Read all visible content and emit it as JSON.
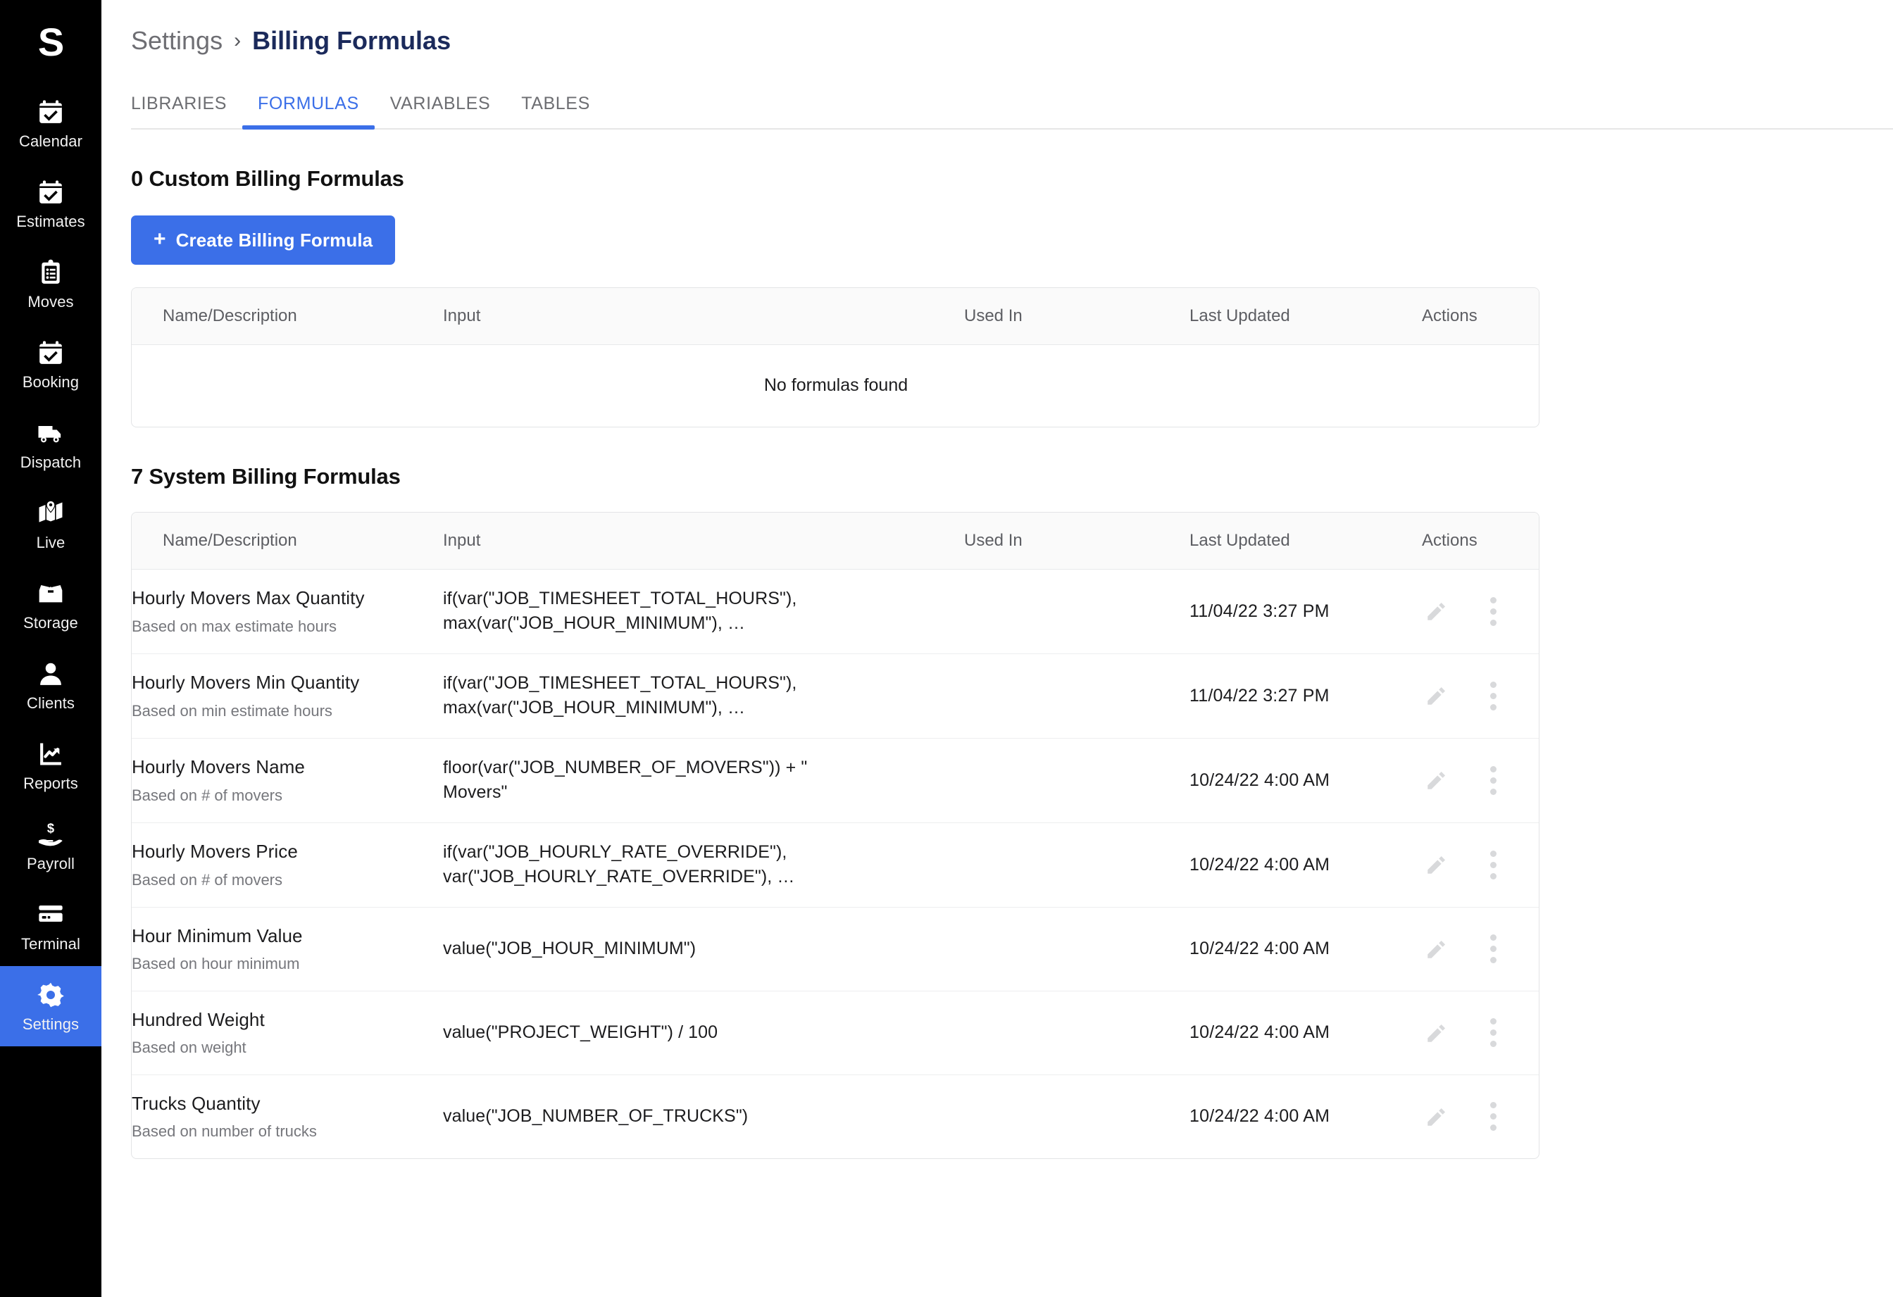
{
  "sidebar": {
    "brand": "S",
    "items": [
      {
        "label": "Calendar",
        "icon": "calendar-check-icon",
        "active": false
      },
      {
        "label": "Estimates",
        "icon": "calendar-check-icon",
        "active": false
      },
      {
        "label": "Moves",
        "icon": "clipboard-list-icon",
        "active": false
      },
      {
        "label": "Booking",
        "icon": "calendar-check-icon",
        "active": false
      },
      {
        "label": "Dispatch",
        "icon": "truck-icon",
        "active": false
      },
      {
        "label": "Live",
        "icon": "map-pin-icon",
        "active": false
      },
      {
        "label": "Storage",
        "icon": "open-box-icon",
        "active": false
      },
      {
        "label": "Clients",
        "icon": "person-icon",
        "active": false
      },
      {
        "label": "Reports",
        "icon": "chart-line-icon",
        "active": false
      },
      {
        "label": "Payroll",
        "icon": "hand-dollar-icon",
        "active": false
      },
      {
        "label": "Terminal",
        "icon": "credit-card-icon",
        "active": false
      },
      {
        "label": "Settings",
        "icon": "gear-icon",
        "active": true
      }
    ]
  },
  "breadcrumb": {
    "parent": "Settings",
    "separator": "›",
    "current": "Billing Formulas"
  },
  "tabs": [
    {
      "label": "LIBRARIES",
      "active": false
    },
    {
      "label": "FORMULAS",
      "active": true
    },
    {
      "label": "VARIABLES",
      "active": false
    },
    {
      "label": "TABLES",
      "active": false
    }
  ],
  "custom_section": {
    "title": "0 Custom Billing Formulas",
    "create_button": "Create Billing Formula",
    "create_button_plus": "+",
    "columns": [
      "Name/Description",
      "Input",
      "Used In",
      "Last Updated",
      "Actions"
    ],
    "empty_message": "No formulas found"
  },
  "system_section": {
    "title": "7 System Billing Formulas",
    "columns": [
      "Name/Description",
      "Input",
      "Used In",
      "Last Updated",
      "Actions"
    ],
    "rows": [
      {
        "name": "Hourly Movers Max Quantity",
        "description": "Based on max estimate hours",
        "input": "if(var(\"JOB_TIMESHEET_TOTAL_HOURS\"),\nmax(var(\"JOB_HOUR_MINIMUM\"), …",
        "used_in": "",
        "last_updated": "11/04/22 3:27 PM"
      },
      {
        "name": "Hourly Movers Min Quantity",
        "description": "Based on min estimate hours",
        "input": "if(var(\"JOB_TIMESHEET_TOTAL_HOURS\"),\nmax(var(\"JOB_HOUR_MINIMUM\"), …",
        "used_in": "",
        "last_updated": "11/04/22 3:27 PM"
      },
      {
        "name": "Hourly Movers Name",
        "description": "Based on # of movers",
        "input": "floor(var(\"JOB_NUMBER_OF_MOVERS\")) + \"\nMovers\"",
        "used_in": "",
        "last_updated": "10/24/22 4:00 AM"
      },
      {
        "name": "Hourly Movers Price",
        "description": "Based on # of movers",
        "input": "if(var(\"JOB_HOURLY_RATE_OVERRIDE\"),\nvar(\"JOB_HOURLY_RATE_OVERRIDE\"), …",
        "used_in": "",
        "last_updated": "10/24/22 4:00 AM"
      },
      {
        "name": "Hour Minimum Value",
        "description": "Based on hour minimum",
        "input": "value(\"JOB_HOUR_MINIMUM\")",
        "used_in": "",
        "last_updated": "10/24/22 4:00 AM"
      },
      {
        "name": "Hundred Weight",
        "description": "Based on weight",
        "input": "value(\"PROJECT_WEIGHT\") / 100",
        "used_in": "",
        "last_updated": "10/24/22 4:00 AM"
      },
      {
        "name": "Trucks Quantity",
        "description": "Based on number of trucks",
        "input": "value(\"JOB_NUMBER_OF_TRUCKS\")",
        "used_in": "",
        "last_updated": "10/24/22 4:00 AM"
      }
    ]
  },
  "colors": {
    "accent": "#3B6FE8",
    "sidebar_bg": "#000000",
    "breadcrumb_current": "#1b2a5b",
    "table_header_bg": "#fafafa",
    "icon_muted": "#d8d9db"
  }
}
